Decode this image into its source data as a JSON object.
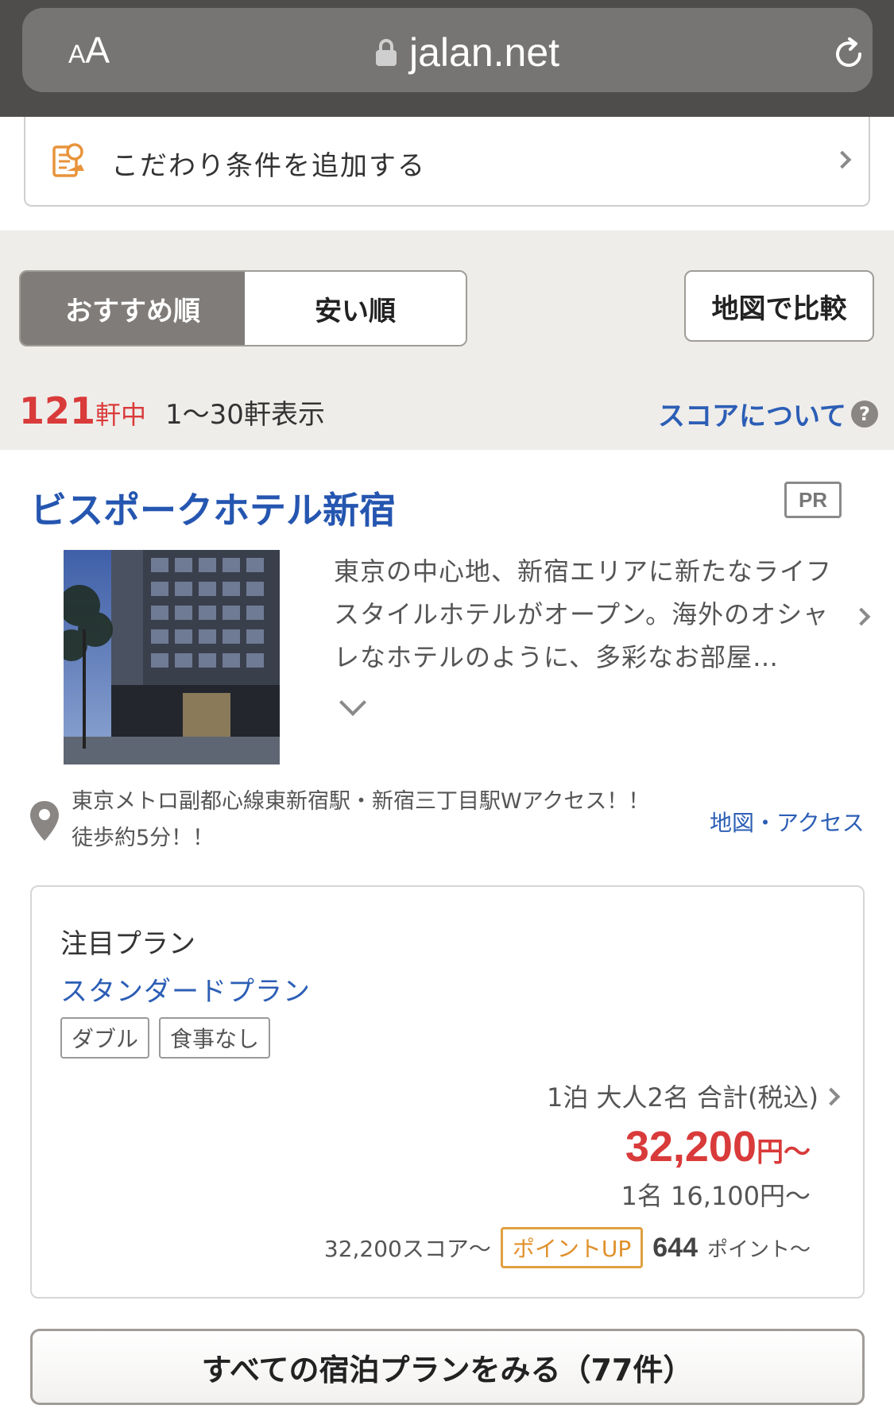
{
  "browser": {
    "text_size_small": "A",
    "text_size_big": "A",
    "url": "jalan.net",
    "icons": {
      "lock": "lock-icon",
      "reload": "reload-icon"
    }
  },
  "conditions": {
    "label": "こだわり条件を追加する",
    "icon": "document-edit-icon"
  },
  "sort": {
    "recommended": "おすすめ順",
    "cheapest": "安い順",
    "active": "recommended",
    "map_compare": "地図で比較"
  },
  "results": {
    "total": "121",
    "total_unit": "軒中",
    "range": "1〜30軒表示",
    "score_link": "スコアについて",
    "help_glyph": "?"
  },
  "hotel": {
    "name": "ビスポークホテル新宿",
    "badge": "PR",
    "description": "東京の中心地、新宿エリアに新たなライフスタイルホテルがオープン。海外のオシャレなホテルのように、多彩なお部屋…",
    "access_line1": "東京メトロ副都心線東新宿駅・新宿三丁目駅Wアクセス！！",
    "access_line2": "徒歩約5分！！",
    "map_access": "地図・アクセス"
  },
  "plan": {
    "heading": "注目プラン",
    "name": "スタンダードプラン",
    "tags": [
      "ダブル",
      "食事なし"
    ],
    "price_condition": "1泊 大人2名 合計(税込)",
    "price_total": "32,200",
    "price_total_unit": "円〜",
    "price_per_person": "1名 16,100円〜",
    "score": "32,200スコア〜",
    "point_up_label": "ポイントUP",
    "points": "644",
    "points_unit": "ポイント〜"
  },
  "all_plans_button": "すべての宿泊プランをみる（77件）",
  "colors": {
    "accent_red": "#d93a3a",
    "link_blue": "#2c5eb5",
    "hotel_name_blue": "#2556b0",
    "point_orange": "#e0902a",
    "band_bg": "#efedea"
  }
}
